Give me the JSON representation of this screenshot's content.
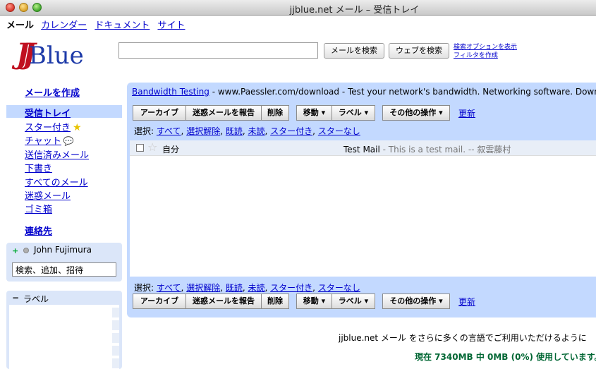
{
  "window": {
    "title": "jjblue.net メール – 受信トレイ"
  },
  "topnav": {
    "current": "メール",
    "links": [
      "カレンダー",
      "ドキュメント",
      "サイト"
    ]
  },
  "logo": {
    "jj": "JJ",
    "blue": "Blue"
  },
  "search": {
    "mail_button": "メールを検索",
    "web_button": "ウェブを検索",
    "options_link": "検索オプションを表示",
    "filter_link": "フィルタを作成"
  },
  "sidebar": {
    "compose": "メールを作成",
    "inbox": "受信トレイ",
    "items": [
      "スター付き",
      "チャット",
      "送信済みメール",
      "下書き",
      "すべてのメール",
      "迷惑メール",
      "ゴミ箱"
    ],
    "contacts": "連絡先",
    "chat_box": {
      "plus": "+",
      "user": "John Fujimura",
      "input_value": "検索、追加、招待"
    },
    "labels_box": {
      "minus": "−",
      "title": "ラベル"
    }
  },
  "ad": {
    "link": "Bandwidth Testing",
    "text": " - www.Paessler.com/download - Test your network's bandwidth. Networking software. Download now"
  },
  "toolbar": {
    "archive": "アーカイブ",
    "spam": "迷惑メールを報告",
    "delete": "削除",
    "move": "移動 ▾",
    "label": "ラベル ▾",
    "more": "その他の操作 ▾",
    "refresh": "更新"
  },
  "select": {
    "label": "選択: ",
    "options": [
      "すべて",
      "選択解除",
      "既読",
      "未読",
      "スター付き",
      "スターなし"
    ]
  },
  "messages": [
    {
      "sender": "自分",
      "subject": "Test Mail",
      "snippet": " - This is a test mail. -- 叙雲藤村"
    }
  ],
  "footer": {
    "lang_text": "jjblue.net メール をさらに多くの言語でご利用いただけるように",
    "usage": "現在 7340MB 中 0MB (0%) 使用しています。"
  }
}
